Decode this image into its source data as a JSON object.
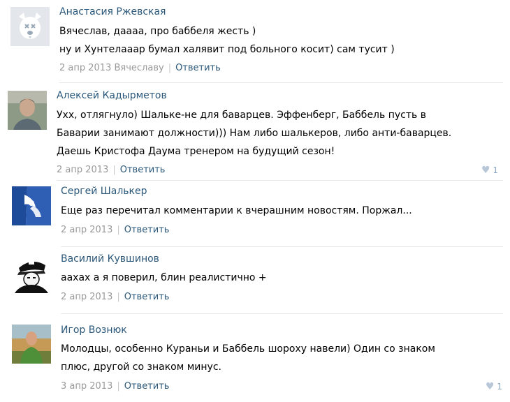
{
  "comments": [
    {
      "author": "Анастасия Ржевская",
      "lines": [
        "Вячеслав, даааа, про баббеля жесть )",
        "ну и Хунтелааар бумал халявит под больного косит) сам тусит )"
      ],
      "date": "2 апр 2013",
      "addressee": "Вячеславу",
      "reply_label": "Ответить",
      "avatar_icon": "deactivated-dog-avatar-icon"
    },
    {
      "author": "Алексей Кадырметов",
      "lines": [
        "Ухх, отлягнуло) Шальке-не для баварцев. Эффенберг, Баббель пусть в",
        "Баварии занимают должности))) Нам либо шалькеров, либо анти-баварцев.",
        "Даешь Кристофа Даума тренером на будущий сезон!"
      ],
      "date": "2 апр 2013",
      "reply_label": "Ответить",
      "likes": "1",
      "avatar_icon": "photo-avatar"
    },
    {
      "author": "Сергей Шалькер",
      "lines": [
        "Еще раз перечитал комментарии к вчерашним новостям. Поржал..."
      ],
      "date": "2 апр 2013",
      "reply_label": "Ответить",
      "avatar_icon": "schalke-flag-avatar"
    },
    {
      "author": "Василий Кувшинов",
      "lines": [
        "аахах а я поверил, блин реалистично +"
      ],
      "date": "2 апр 2013",
      "reply_label": "Ответить",
      "avatar_icon": "officer-cap-avatar"
    },
    {
      "author": "Игор Вознюк",
      "lines": [
        "Молодцы, особенно Кураньи и Баббель шороху навели) Один со знаком",
        "плюс, другой со знаком минус."
      ],
      "date": "3 апр 2013",
      "reply_label": "Ответить",
      "likes": "1",
      "avatar_icon": "photo-avatar"
    }
  ],
  "colors": {
    "link": "#2b587a",
    "meta": "#999999",
    "divider": "#e7e8ec",
    "like": "#8ba7c2"
  }
}
